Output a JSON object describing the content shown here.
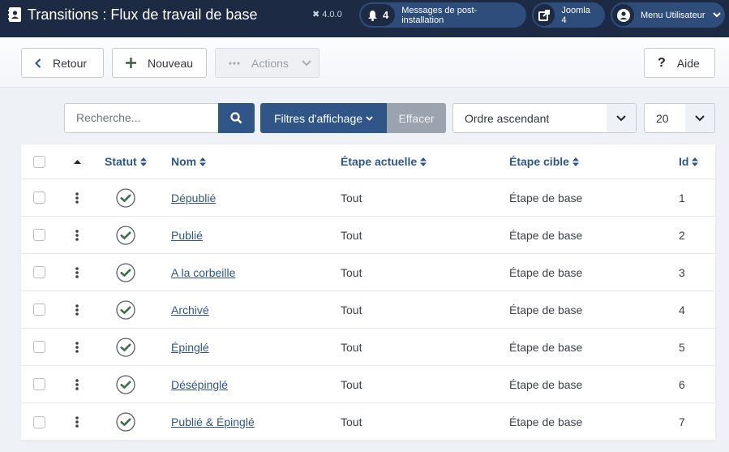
{
  "header": {
    "title": "Transitions : Flux de travail de base",
    "version": "4.0.0",
    "notifications": {
      "count": "4",
      "label": "Messages de post-installation"
    },
    "site_link": "Joomla 4",
    "user_menu": "Menu Utilisateur"
  },
  "toolbar": {
    "back": "Retour",
    "new": "Nouveau",
    "actions": "Actions",
    "help": "Aide"
  },
  "filters": {
    "search_placeholder": "Recherche...",
    "filter_options": "Filtres d'affichage",
    "clear": "Effacer",
    "ordering": "Ordre ascendant",
    "limit": "20"
  },
  "table": {
    "columns": {
      "status": "Statut",
      "name": "Nom",
      "current_stage": "Étape actuelle",
      "target_stage": "Étape cible",
      "id": "Id"
    },
    "rows": [
      {
        "name": "Dépublié",
        "current": "Tout",
        "target": "Étape de base",
        "id": "1"
      },
      {
        "name": "Publié",
        "current": "Tout",
        "target": "Étape de base",
        "id": "2"
      },
      {
        "name": "A la corbeille",
        "current": "Tout",
        "target": "Étape de base",
        "id": "3"
      },
      {
        "name": "Archivé",
        "current": "Tout",
        "target": "Étape de base",
        "id": "4"
      },
      {
        "name": "Épinglé",
        "current": "Tout",
        "target": "Étape de base",
        "id": "5"
      },
      {
        "name": "Désépinglé",
        "current": "Tout",
        "target": "Étape de base",
        "id": "6"
      },
      {
        "name": "Publié & Épinglé",
        "current": "Tout",
        "target": "Étape de base",
        "id": "7"
      }
    ]
  },
  "colors": {
    "header_bg": "#1c2a44",
    "pill_bg": "#2f4d7a",
    "primary": "#2f5686",
    "status_ok": "#3c6e4b"
  }
}
